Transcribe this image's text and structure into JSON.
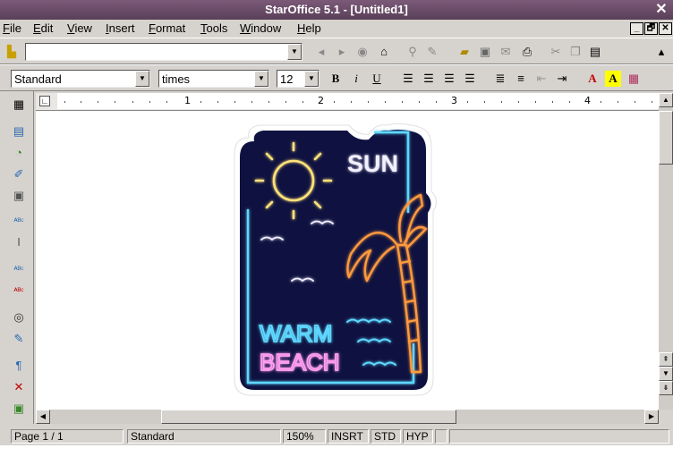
{
  "window": {
    "title": "StarOffice 5.1 - [Untitled1]",
    "close_glyph": "✕"
  },
  "menu": [
    "File",
    "Edit",
    "View",
    "Insert",
    "Format",
    "Tools",
    "Window",
    "Help"
  ],
  "window_controls": [
    "_",
    "🗗",
    "✕"
  ],
  "toolbar": {
    "url_value": "",
    "paragraph_style": "Standard",
    "font_name": "times",
    "font_size": "12",
    "bold": "B",
    "italic": "i",
    "underline": "U"
  },
  "ruler": {
    "marks": [
      "1",
      "2",
      "3",
      "4"
    ]
  },
  "sticker": {
    "sun": "SUN",
    "warm": "WARM",
    "beach": "BEACH",
    "colors": {
      "bg": "#0f1240",
      "cyan": "#5fd8ff",
      "yellow": "#ffe27a",
      "pink": "#ff9ef0",
      "orange": "#ff9a3c",
      "white": "#f2f0ff"
    }
  },
  "status": {
    "page": "Page 1 / 1",
    "style": "Standard",
    "zoom": "150%",
    "insert": "INSRT",
    "std": "STD",
    "hyp": "HYP"
  }
}
